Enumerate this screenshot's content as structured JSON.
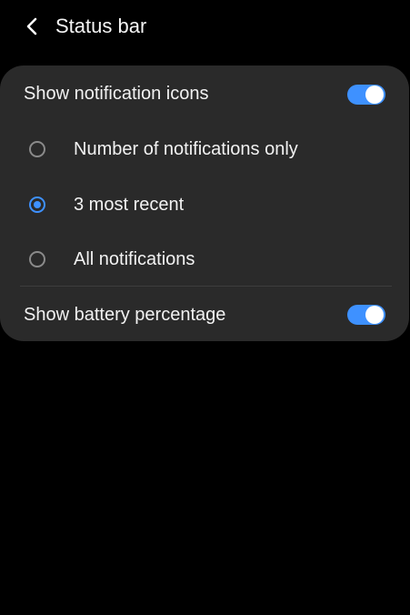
{
  "header": {
    "back_icon": "chevron-left-icon",
    "title": "Status bar"
  },
  "settings": {
    "show_notification_icons": {
      "label": "Show notification icons",
      "enabled": true
    },
    "options": [
      {
        "label": "Number of notifications only",
        "selected": false
      },
      {
        "label": "3 most recent",
        "selected": true
      },
      {
        "label": "All notifications",
        "selected": false
      }
    ],
    "show_battery_percentage": {
      "label": "Show battery percentage",
      "enabled": true
    }
  },
  "colors": {
    "accent": "#3e91ff",
    "background": "#000000",
    "card": "#2a2a2a"
  }
}
